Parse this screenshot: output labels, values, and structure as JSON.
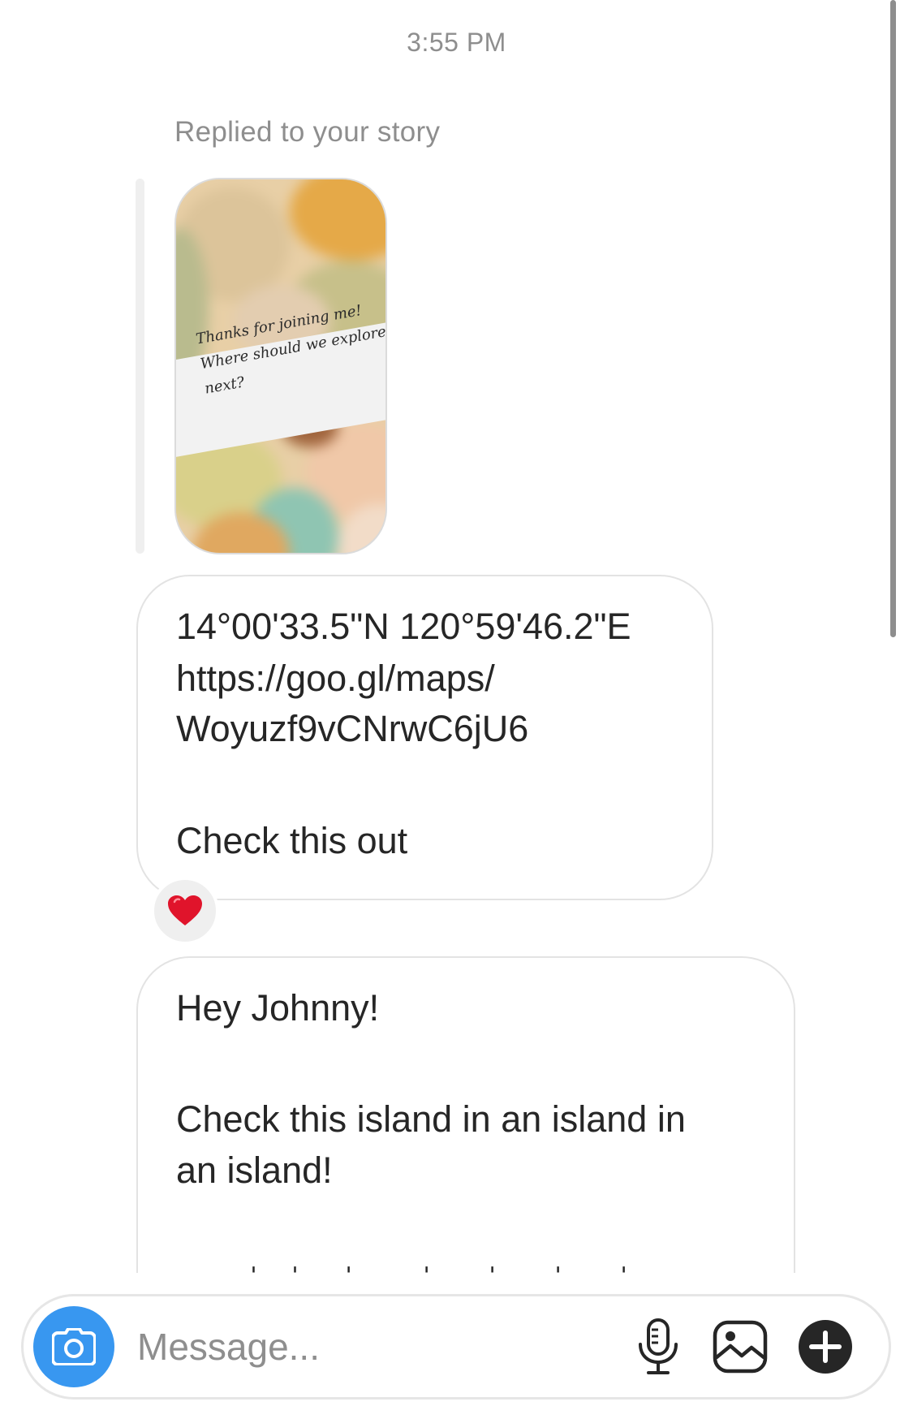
{
  "thread": {
    "timestamp": "3:55 PM",
    "reply_label": "Replied to your story",
    "story": {
      "caption_lines": [
        "Thanks for joining me!",
        "Where should we explore",
        "next?"
      ]
    },
    "messages": [
      {
        "lines": [
          "14°00'33.5\"N 120°59'46.2\"E",
          "https://goo.gl/maps/",
          "Woyuzf9vCNrwC6jU6",
          "Check this out"
        ],
        "reaction": "heart"
      },
      {
        "lines": [
          "Hey Johnny!",
          "Check this island in an island in",
          "an island!"
        ]
      }
    ]
  },
  "composer": {
    "placeholder": "Message...",
    "camera_icon": "camera-icon",
    "mic_icon": "microphone-icon",
    "gallery_icon": "gallery-icon",
    "plus_icon": "plus-icon"
  },
  "colors": {
    "accent": "#3897f0",
    "secondary_text": "#8e8e8e",
    "bubble_border": "#e3e3e3",
    "reaction": "#e0142b"
  }
}
